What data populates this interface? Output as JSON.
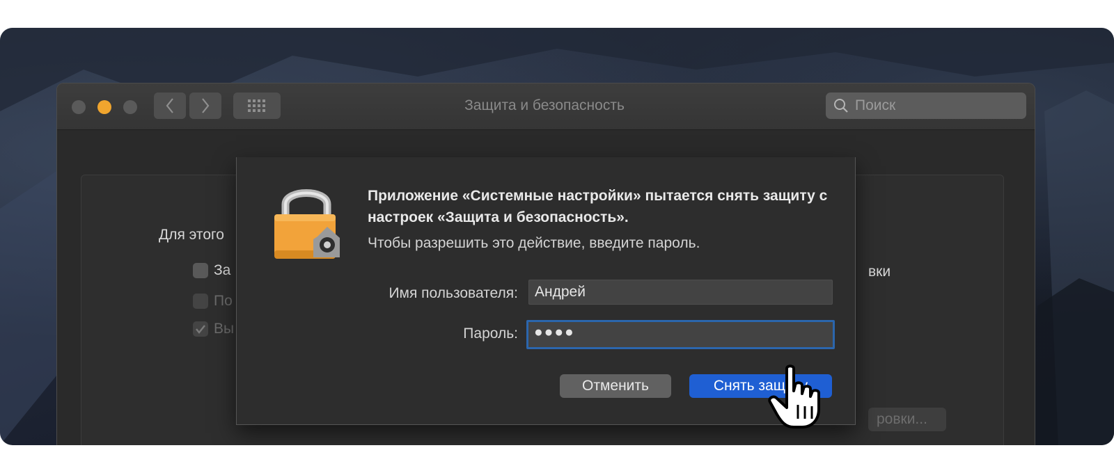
{
  "window": {
    "title": "Защита и безопасность",
    "search_placeholder": "Поиск"
  },
  "background": {
    "heading_fragment": "Для этого",
    "rows": [
      {
        "fragment": "За",
        "checked": false,
        "enabled": true
      },
      {
        "fragment": "По",
        "checked": false,
        "enabled": false
      },
      {
        "fragment": "Вы",
        "checked": true,
        "enabled": false
      }
    ],
    "right_fragment": "вки",
    "right_button_fragment": "ровки..."
  },
  "dialog": {
    "title": "Приложение «Системные настройки» пытается снять защиту с настроек «Защита и безопасность».",
    "subtitle": "Чтобы разрешить это действие, введите пароль.",
    "username_label": "Имя пользователя:",
    "username_value": "Андрей",
    "password_label": "Пароль:",
    "password_value": "●●●●",
    "cancel_label": "Отменить",
    "unlock_label": "Снять защиту"
  },
  "colors": {
    "accent": "#1f5fd3",
    "lock_body": "#f2a33a",
    "minimize_light": "#f0a52e",
    "focus_ring": "#2b66ad"
  },
  "icons": [
    "chevron-left-icon",
    "chevron-right-icon",
    "grid-icon",
    "search-icon",
    "lock-icon",
    "checkmark-icon",
    "hand-pointer-icon"
  ]
}
